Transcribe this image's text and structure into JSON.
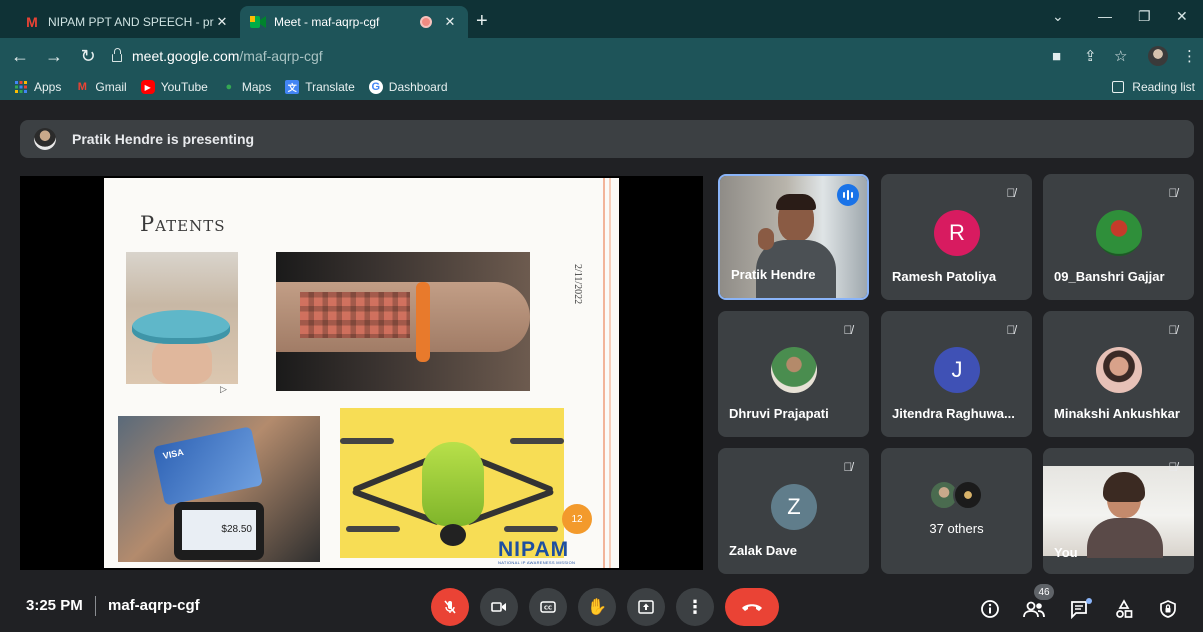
{
  "browser": {
    "tabs": [
      {
        "label": "NIPAM PPT AND SPEECH - prach",
        "favicon": "M"
      },
      {
        "label": "Meet - maf-aqrp-cgf"
      }
    ],
    "url_host": "meet.google.com",
    "url_path": "/maf-aqrp-cgf",
    "bookmarks": [
      {
        "label": "Apps"
      },
      {
        "label": "Gmail",
        "icon_text": "M"
      },
      {
        "label": "YouTube",
        "icon_text": "▶"
      },
      {
        "label": "Maps",
        "icon_text": "●"
      },
      {
        "label": "Translate",
        "icon_text": "文"
      },
      {
        "label": "Dashboard",
        "icon_text": "G"
      }
    ],
    "reading_list": "Reading list"
  },
  "meet": {
    "presenting_banner": "Pratik Hendre is presenting",
    "slide": {
      "title": "Patents",
      "date": "2/11/2022",
      "card_brand": "VISA",
      "phone_amount": "$28.50",
      "slide_number": "12",
      "logo": "NIPAM",
      "logo_sub": "NATIONAL IP AWARENESS MISSION"
    },
    "participants": [
      {
        "name": "Pratik Hendre"
      },
      {
        "name": "Ramesh Patoliya",
        "initial": "R",
        "color": "#d81b60"
      },
      {
        "name": "09_Banshri Gajjar"
      },
      {
        "name": "Dhruvi Prajapati"
      },
      {
        "name": "Jitendra Raghuwa...",
        "initial": "J",
        "color": "#3f51b5"
      },
      {
        "name": "Minakshi Ankushkar"
      },
      {
        "name": "Zalak Dave",
        "initial": "Z",
        "color": "#607d8b"
      },
      {
        "name": "37 others"
      },
      {
        "name": "You"
      }
    ],
    "footer": {
      "time": "3:25 PM",
      "code": "maf-aqrp-cgf",
      "people_count": "46"
    }
  }
}
